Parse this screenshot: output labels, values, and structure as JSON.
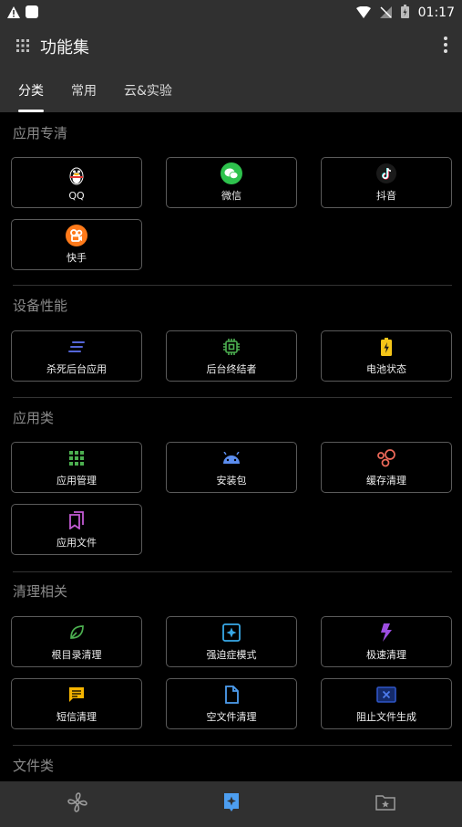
{
  "statusbar": {
    "time": "01:17"
  },
  "appbar": {
    "title": "功能集"
  },
  "tabs": [
    {
      "label": "分类",
      "active": true
    },
    {
      "label": "常用",
      "active": false
    },
    {
      "label": "云&实验",
      "active": false
    }
  ],
  "sections": [
    {
      "title": "应用专清",
      "items": [
        {
          "label": "QQ",
          "icon": "penguin-icon"
        },
        {
          "label": "微信",
          "icon": "wechat-icon"
        },
        {
          "label": "抖音",
          "icon": "tiktok-icon"
        },
        {
          "label": "快手",
          "icon": "kuaishou-icon"
        }
      ]
    },
    {
      "title": "设备性能",
      "items": [
        {
          "label": "杀死后台应用",
          "icon": "speed-lines-icon"
        },
        {
          "label": "后台终结者",
          "icon": "chip-icon"
        },
        {
          "label": "电池状态",
          "icon": "battery-icon"
        }
      ]
    },
    {
      "title": "应用类",
      "items": [
        {
          "label": "应用管理",
          "icon": "grid-icon"
        },
        {
          "label": "安装包",
          "icon": "android-icon"
        },
        {
          "label": "缓存清理",
          "icon": "bubbles-icon"
        },
        {
          "label": "应用文件",
          "icon": "bookmarks-icon"
        }
      ]
    },
    {
      "title": "清理相关",
      "items": [
        {
          "label": "根目录清理",
          "icon": "leaf-icon"
        },
        {
          "label": "强迫症模式",
          "icon": "sparkle-icon"
        },
        {
          "label": "极速清理",
          "icon": "bolt-icon"
        },
        {
          "label": "短信清理",
          "icon": "message-icon"
        },
        {
          "label": "空文件清理",
          "icon": "file-icon"
        },
        {
          "label": "阻止文件生成",
          "icon": "block-file-icon"
        }
      ]
    },
    {
      "title": "文件类",
      "items": []
    }
  ],
  "colors": {
    "bar": "#303030",
    "background": "#000000",
    "card_border": "#5a5a5a",
    "section_title": "#8a8a8a"
  }
}
